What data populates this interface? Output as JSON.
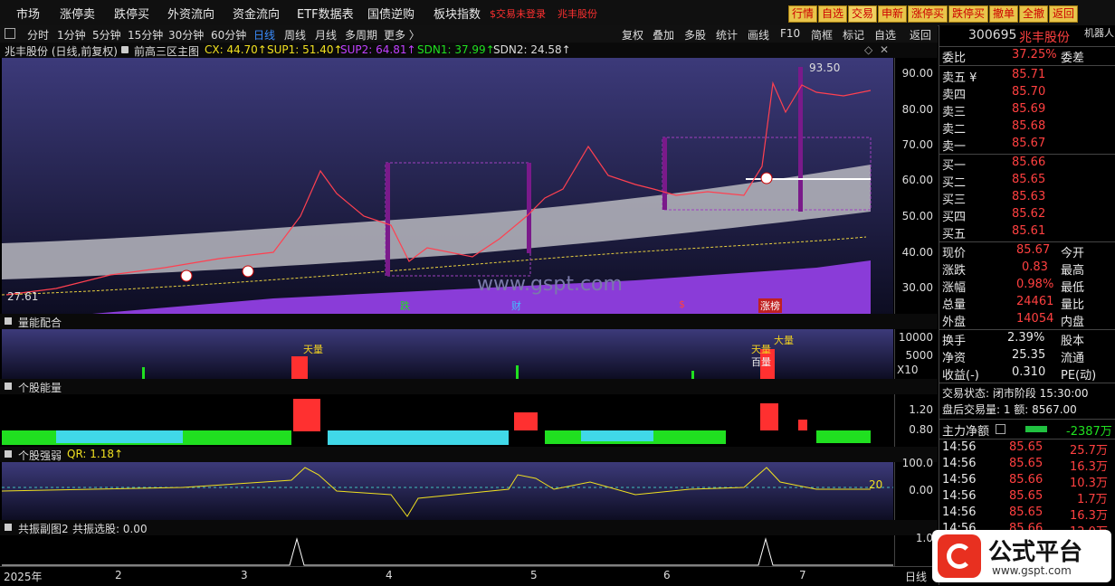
{
  "menu": {
    "items": [
      "市场",
      "涨停卖",
      "跌停买",
      "外资流向",
      "资金流向",
      "ETF数据表",
      "国债逆购",
      "板块指数"
    ],
    "notice": "$交易未登录",
    "stock_name": "兆丰股份",
    "toolbar": [
      "行情",
      "自选",
      "交易",
      "申新",
      "涨停买",
      "跌停买",
      "撤单",
      "全撤",
      "返回"
    ]
  },
  "periods": [
    "分时",
    "1分钟",
    "5分钟",
    "15分钟",
    "30分钟",
    "60分钟",
    "日线",
    "周线",
    "月线",
    "多周期",
    "更多 〉"
  ],
  "tools": [
    "复权",
    "叠加",
    "多股",
    "统计",
    "画线",
    "F10",
    "简框",
    "标记",
    "自选",
    "返回"
  ],
  "main_panel": {
    "title": "兆丰股份 (日线,前复权)",
    "indicator": "前高三区主图",
    "cx": "CX: 44.70↑",
    "sup1": "SUP1: 51.40↑",
    "sup2": "SUP2: 64.81↑",
    "sdn1": "SDN1: 37.99↑",
    "sdn2": "SDN2: 24.58↑",
    "high_label": "93.50",
    "low_label": "27.61",
    "watermark": "www.gspt.com",
    "markers": [
      "跌",
      "财",
      "$",
      "涨榜"
    ],
    "axis": [
      "90.00",
      "80.00",
      "70.00",
      "60.00",
      "50.00",
      "40.00",
      "30.00"
    ]
  },
  "volume_panel": {
    "title": "量能配合",
    "axis": [
      "10000",
      "5000"
    ],
    "unit": "X10",
    "labels": [
      "天量",
      "天量",
      "大量",
      "百量"
    ]
  },
  "energy_panel": {
    "title": "个股能量",
    "axis": [
      "1.20",
      "0.80"
    ]
  },
  "strength_panel": {
    "title": "个股强弱",
    "qr": "QR: 1.18↑",
    "axis": [
      "100.0",
      "0.00"
    ],
    "level": "20"
  },
  "resonance_panel": {
    "title": "共振副图2",
    "value": "共振选股: 0.00",
    "axis": [
      "1.0"
    ]
  },
  "time_axis": [
    "2025年",
    "2",
    "3",
    "4",
    "5",
    "6",
    "7"
  ],
  "bottom_tab": "日线",
  "quote": {
    "code": "300695",
    "name": "兆丰股份",
    "robot": "机器人 概念",
    "weibi_label": "委比",
    "weibi": "37.25%",
    "weicha_label": "委差",
    "asks": [
      {
        "label": "卖五 ¥",
        "price": "85.71"
      },
      {
        "label": "卖四",
        "price": "85.70"
      },
      {
        "label": "卖三",
        "price": "85.69"
      },
      {
        "label": "卖二",
        "price": "85.68"
      },
      {
        "label": "卖一",
        "price": "85.67"
      }
    ],
    "bids": [
      {
        "label": "买一",
        "price": "85.66"
      },
      {
        "label": "买二",
        "price": "85.65"
      },
      {
        "label": "买三",
        "price": "85.63"
      },
      {
        "label": "买四",
        "price": "85.62"
      },
      {
        "label": "买五",
        "price": "85.61"
      }
    ],
    "stats": [
      {
        "l1": "现价",
        "v1": "85.67",
        "l2": "今开"
      },
      {
        "l1": "涨跌",
        "v1": "0.83",
        "l2": "最高"
      },
      {
        "l1": "涨幅",
        "v1": "0.98%",
        "l2": "最低"
      },
      {
        "l1": "总量",
        "v1": "24461",
        "l2": "量比"
      },
      {
        "l1": "外盘",
        "v1": "14054",
        "l2": "内盘"
      }
    ],
    "stats2": [
      {
        "l1": "换手",
        "v1": "2.39%",
        "l2": "股本"
      },
      {
        "l1": "净资",
        "v1": "25.35",
        "l2": "流通"
      },
      {
        "l1": "收益(-)",
        "v1": "0.310",
        "l2": "PE(动)"
      }
    ],
    "trade_state": "交易状态: 闭市阶段 15:30:00",
    "after_hours": "盘后交易量: 1  额: 8567.00",
    "main_flow_label": "主力净额",
    "main_flow": "-2387万",
    "ticks": [
      {
        "t": "14:56",
        "p": "85.65",
        "v": "25.7万"
      },
      {
        "t": "14:56",
        "p": "85.65",
        "v": "16.3万"
      },
      {
        "t": "14:56",
        "p": "85.66",
        "v": "10.3万"
      },
      {
        "t": "14:56",
        "p": "85.65",
        "v": "1.7万"
      },
      {
        "t": "14:56",
        "p": "85.65",
        "v": "16.3万"
      },
      {
        "t": "14:56",
        "p": "85.66",
        "v": "12.0万"
      }
    ]
  },
  "logo": {
    "text": "公式平台",
    "url": "www.gspt.com"
  }
}
